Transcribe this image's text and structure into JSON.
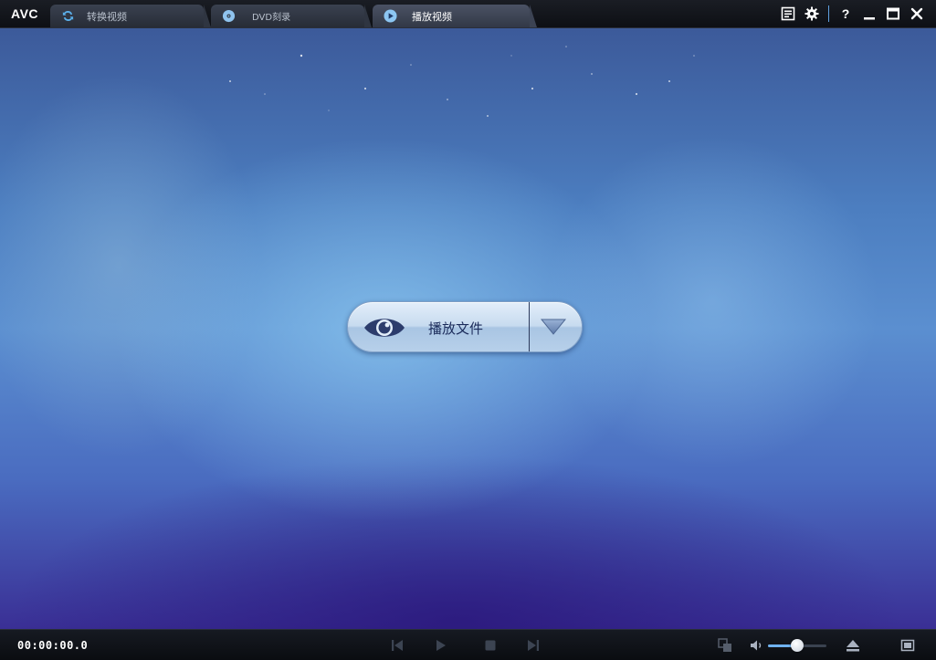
{
  "app": {
    "logo": "AVC"
  },
  "tabs": [
    {
      "label": "转换视频",
      "icon": "refresh-icon",
      "active": false
    },
    {
      "label": "DVD刻录",
      "icon": "disc-icon",
      "active": false
    },
    {
      "label": "播放视频",
      "icon": "play-circle-icon",
      "active": true
    }
  ],
  "window_controls": {
    "help_label": "?",
    "icons": [
      "task-list-icon",
      "gear-icon",
      "help-icon",
      "minimize-icon",
      "maximize-icon",
      "close-icon"
    ]
  },
  "main": {
    "play_button_label": "播放文件",
    "play_button_icon": "eye-icon",
    "dropdown_icon": "triangle-down-icon"
  },
  "player": {
    "timecode": "00:00:00.0",
    "volume_level": 0.5,
    "icons": [
      "skip-back-icon",
      "play-icon",
      "stop-icon",
      "skip-forward-icon",
      "snapshot-icon",
      "volume-icon",
      "eject-icon",
      "fullscreen-icon"
    ]
  },
  "colors": {
    "accent": "#6fb2f0",
    "tab_active_text": "#ffffff",
    "tab_inactive_text": "#b8c0cc",
    "button_text": "#1b2b5a"
  }
}
